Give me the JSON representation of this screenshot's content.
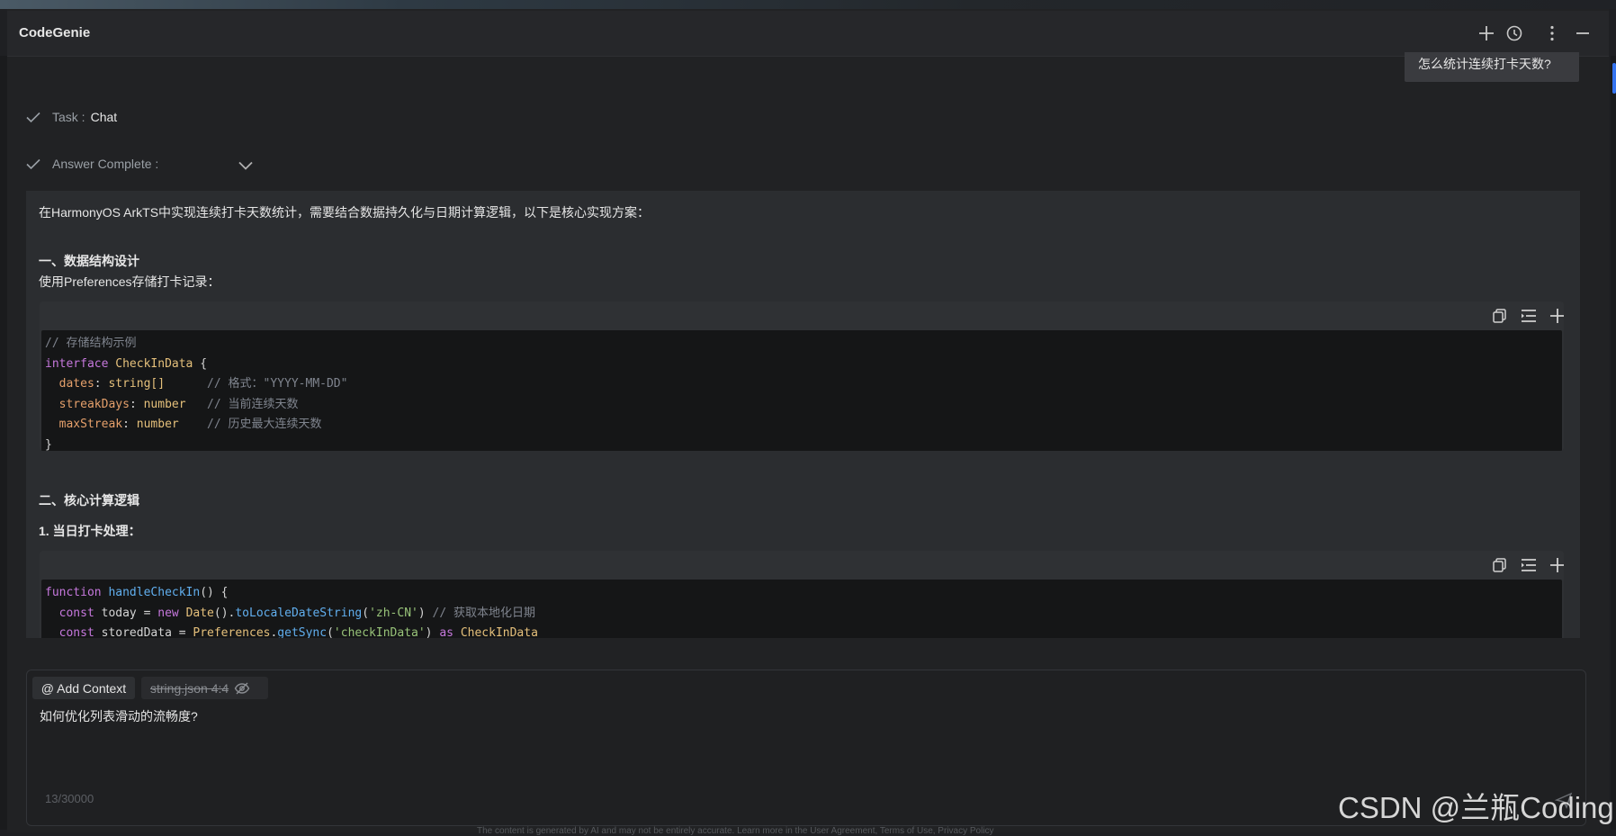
{
  "app": {
    "title": "CodeGenie"
  },
  "header": {
    "icons": [
      "plus-icon",
      "history-icon",
      "more-vertical-icon",
      "minimize-icon"
    ]
  },
  "user_message": "怎么统计连续打卡天数?",
  "status": {
    "task_label": "Task :",
    "task_value": "Chat",
    "answer_label": "Answer Complete :"
  },
  "answer": {
    "intro": "在HarmonyOS ArkTS中实现连续打卡天数统计，需要结合数据持久化与日期计算逻辑，以下是核心实现方案：",
    "section1_title": "一、数据结构设计",
    "section1_desc": "使用Preferences存储打卡记录：",
    "code1": {
      "line1": "// 存储结构示例",
      "line2_kw": "interface",
      "line2_type": "CheckInData",
      "line2_brace": " {",
      "line3_prop": "dates",
      "line3_type": "string[]",
      "line3_comment": "// 格式：\"YYYY-MM-DD\"",
      "line4_prop": "streakDays",
      "line4_type": "number",
      "line4_comment": "// 当前连续天数",
      "line5_prop": "maxStreak",
      "line5_type": "number",
      "line5_comment": "// 历史最大连续天数",
      "line6": "}"
    },
    "section2_title": "二、核心计算逻辑",
    "section2_sub": "1. 当日打卡处理：",
    "code2": {
      "l1_kw": "function",
      "l1_fn": "handleCheckIn",
      "l1_rest": "() {",
      "l2_kw": "const",
      "l2_var": " today = ",
      "l2_new": "new",
      "l2_date": "Date",
      "l2_call": "toLocaleDateString",
      "l2_str": "'zh-CN'",
      "l2_comment": "// 获取本地化日期",
      "l3_kw": "const",
      "l3_var": " storedData = ",
      "l3_obj": "Preferences",
      "l3_call": "getSync",
      "l3_str": "'checkInData'",
      "l3_as": "as",
      "l3_type": "CheckInData"
    },
    "code_toolbar_icons": [
      "copy-icon",
      "insert-icon",
      "add-icon"
    ]
  },
  "input": {
    "add_context": "@ Add Context",
    "file_chip": "string.json 4:4",
    "text": "如何优化列表滑动的流畅度?",
    "counter": "13/30000"
  },
  "watermark": "CSDN @兰瓶Coding",
  "footnote": "The content is generated by AI and may not be entirely accurate. Learn more in the User Agreement, Terms of Use, Privacy Policy"
}
